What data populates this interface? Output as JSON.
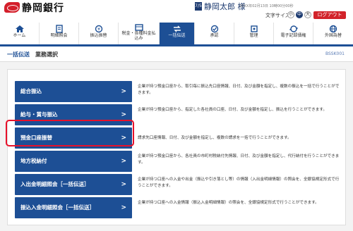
{
  "header": {
    "bank_name": "静岡銀行",
    "user_badge": "7/5",
    "user_name": "静岡太郎 様",
    "last_login": "20XX年02月13日 10時00分00秒",
    "font_size_label": "文字サイズ",
    "font_sizes": [
      "小",
      "中",
      "大"
    ],
    "logout": "ログアウト"
  },
  "nav": {
    "items": [
      {
        "label": "ホーム",
        "icon": "home-icon"
      },
      {
        "label": "明細照会",
        "icon": "document-icon"
      },
      {
        "label": "振込振替",
        "icon": "transfer-icon"
      },
      {
        "label": "税金・各種料金払込み",
        "icon": "tax-icon"
      },
      {
        "label": "一括伝送",
        "icon": "bulk-transfer-icon"
      },
      {
        "label": "承認",
        "icon": "approve-icon"
      },
      {
        "label": "管理",
        "icon": "manage-icon"
      },
      {
        "label": "電子記録債権",
        "icon": "receivable-icon"
      },
      {
        "label": "外国為替",
        "icon": "forex-icon"
      }
    ],
    "active": "一括伝送"
  },
  "breadcrumb": {
    "main": "一括伝送",
    "sub": "業務選択",
    "screen_id": "BSSK001"
  },
  "services": [
    {
      "label": "総合振込",
      "desc": "企業が持つ預金口座から、取引毎に振込先口座情報、日付、及び金額を指定し、複数の振込を一括で行うことができます。"
    },
    {
      "label": "給与・賞与振込",
      "desc": "企業が持つ預金口座から、指定した各社員の口座、日付、及び金額を指定し、振込を行うことができます。"
    },
    {
      "label": "預金口座振替",
      "desc": "請求先口座情報、日付、及び金額を指定し、複数の請求を一括で行うことができます。"
    },
    {
      "label": "地方税納付",
      "desc": "企業が持つ預金口座から、各社員の市町村税納付先情報、日付、及び金額を指定し、代行納付を行うことができます。"
    },
    {
      "label": "入出金明細照会［一括伝送］",
      "desc": "企業が持つ口座への入金や出金（振込や引き落とし等）の情報（入出金明細情報）の照会を、全銀協規定形式で行うことができます。"
    },
    {
      "label": "振込入金明細照会［一括伝送］",
      "desc": "企業が持つ口座への入金情報（振込入金明細情報）の照会を、全銀協規定形式で行うことができます。"
    }
  ],
  "colors": {
    "brand_red": "#d2232a",
    "nav_blue": "#1d4f95",
    "highlight": "#e8102a"
  }
}
